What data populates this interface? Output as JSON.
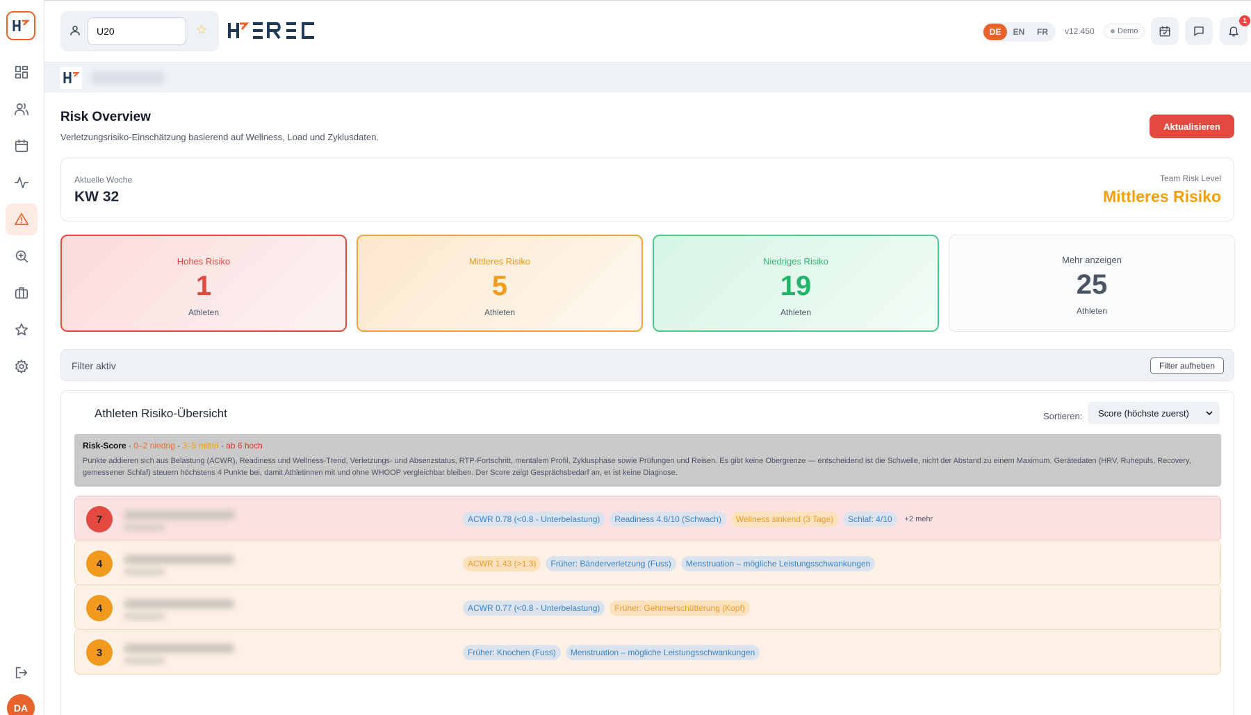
{
  "header": {
    "team_value": "U20",
    "languages": [
      "DE",
      "EN",
      "FR"
    ],
    "active_language": "DE",
    "version": "v12.450",
    "demo": "Demo",
    "notification_count": "1"
  },
  "sidebar": {
    "items": [
      "dashboard-icon",
      "users-icon",
      "calendar-icon",
      "activity-icon",
      "alert-triangle-icon",
      "zoom-in-icon",
      "briefcase-icon",
      "star-icon",
      "gear-icon"
    ],
    "active": "alert-triangle-icon",
    "avatar_initials": "DA"
  },
  "page": {
    "title": "Risk Overview",
    "subtitle": "Verletzungsrisiko-Einschätzung basierend auf Wellness, Load und Zyklusdaten.",
    "refresh_label": "Aktualisieren"
  },
  "week": {
    "label": "Aktuelle Woche",
    "value": "KW 32",
    "team_risk_label": "Team Risk Level",
    "team_risk_value": "Mittleres Risiko"
  },
  "stats": {
    "high": {
      "label": "Hohes Risiko",
      "count": "1",
      "unit": "Athleten"
    },
    "mid": {
      "label": "Mittleres Risiko",
      "count": "5",
      "unit": "Athleten"
    },
    "low": {
      "label": "Niedriges Risiko",
      "count": "19",
      "unit": "Athleten"
    },
    "all": {
      "label": "Mehr anzeigen",
      "count": "25",
      "unit": "Athleten"
    }
  },
  "filter": {
    "text": "Filter aktiv",
    "clear_label": "Filter aufheben"
  },
  "athletes": {
    "title": "Athleten Risiko-Übersicht",
    "sort_label": "Sortieren:",
    "sort_value": "Score (höchste zuerst)",
    "legend": {
      "title": "Risk-Score",
      "sep": " · ",
      "low": "0–2 niedrig",
      "mid": "3–5 mittel",
      "high": "ab 6 hoch",
      "body": "Punkte addieren sich aus Belastung (ACWR), Readiness und Wellness-Trend, Verletzungs- und Absenzstatus, RTP-Fortschritt, mentalem Profil, Zyklusphase sowie Prüfungen und Reisen. Es gibt keine Obergrenze — entscheidend ist die Schwelle, nicht der Abstand zu einem Maximum. Gerätedaten (HRV, Ruhepuls, Recovery, gemessener Schlaf) steuern höchstens 4 Punkte bei, damit Athletinnen mit und ohne WHOOP vergleichbar bleiben. Der Score zeigt Gesprächsbedarf an, er ist keine Diagnose."
    },
    "rows": [
      {
        "score": "7",
        "level": "high",
        "tags": [
          "ACWR 0.78 (<0.8 - Unterbelastung)",
          "Readiness 4.6/10 (Schwach)",
          "Wellness sinkend (3 Tage)",
          "Schlaf: 4/10"
        ],
        "tag_types": [
          "info",
          "info",
          "warn",
          "info"
        ],
        "more": "+2 mehr"
      },
      {
        "score": "4",
        "level": "mid",
        "tags": [
          "ACWR 1.43 (>1.3)",
          "Früher: Bänderverletzung (Fuss)",
          "Menstruation – mögliche Leistungsschwankungen"
        ],
        "tag_types": [
          "warn",
          "info",
          "info"
        ],
        "more": ""
      },
      {
        "score": "4",
        "level": "mid",
        "tags": [
          "ACWR 0.77 (<0.8 - Unterbelastung)",
          "Früher: Gehirnerschütterung (Kopf)"
        ],
        "tag_types": [
          "info",
          "warn"
        ],
        "more": ""
      },
      {
        "score": "3",
        "level": "mid",
        "tags": [
          "Früher: Knochen (Fuss)",
          "Menstruation – mögliche Leistungsschwankungen"
        ],
        "tag_types": [
          "info",
          "info"
        ],
        "more": ""
      }
    ]
  },
  "colors": {
    "accent": "#e8622c",
    "high": "#e24a3f",
    "mid": "#f29a1d",
    "low": "#22b46a"
  }
}
